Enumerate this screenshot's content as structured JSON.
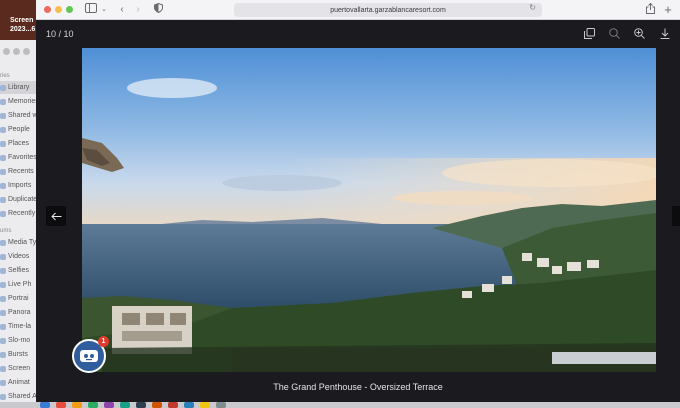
{
  "desktop_file": {
    "label": "Screen 2023...6"
  },
  "photos_sidebar": {
    "library_heading": "ries",
    "albums_heading": "ums",
    "items": [
      {
        "label": "Library",
        "active": true
      },
      {
        "label": "Memories"
      },
      {
        "label": "Shared w"
      },
      {
        "label": "People"
      },
      {
        "label": "Places"
      },
      {
        "label": "Favorites"
      },
      {
        "label": "Recents"
      },
      {
        "label": "Imports"
      },
      {
        "label": "Duplicate"
      },
      {
        "label": "Recently"
      }
    ],
    "media_items": [
      {
        "label": "Media Ty"
      },
      {
        "label": "Videos"
      },
      {
        "label": "Selfies"
      },
      {
        "label": "Live Ph"
      },
      {
        "label": "Portrai"
      },
      {
        "label": "Panora"
      },
      {
        "label": "Time-la"
      },
      {
        "label": "Slo-mo"
      },
      {
        "label": "Bursts"
      },
      {
        "label": "Screen"
      },
      {
        "label": "Animat"
      },
      {
        "label": "Shared A"
      }
    ]
  },
  "browser": {
    "url": "puertovallarta.garzablancaresort.com",
    "traffic_lights": [
      "#ed6a5e",
      "#f5bf4f",
      "#61c554"
    ]
  },
  "lightbox": {
    "counter": "10 / 10",
    "caption": "The Grand Penthouse - Oversized Terrace",
    "tools": [
      "copy-icon",
      "zoom-out-icon",
      "zoom-in-icon",
      "download-icon"
    ]
  },
  "chat_widget": {
    "badge_count": "1"
  },
  "dock_colors": [
    "#3a7bd5",
    "#e74c3c",
    "#f39c12",
    "#27ae60",
    "#8e44ad",
    "#16a085",
    "#2c3e50",
    "#d35400",
    "#c0392b",
    "#2980b9",
    "#f1c40f",
    "#7f8c8d"
  ]
}
